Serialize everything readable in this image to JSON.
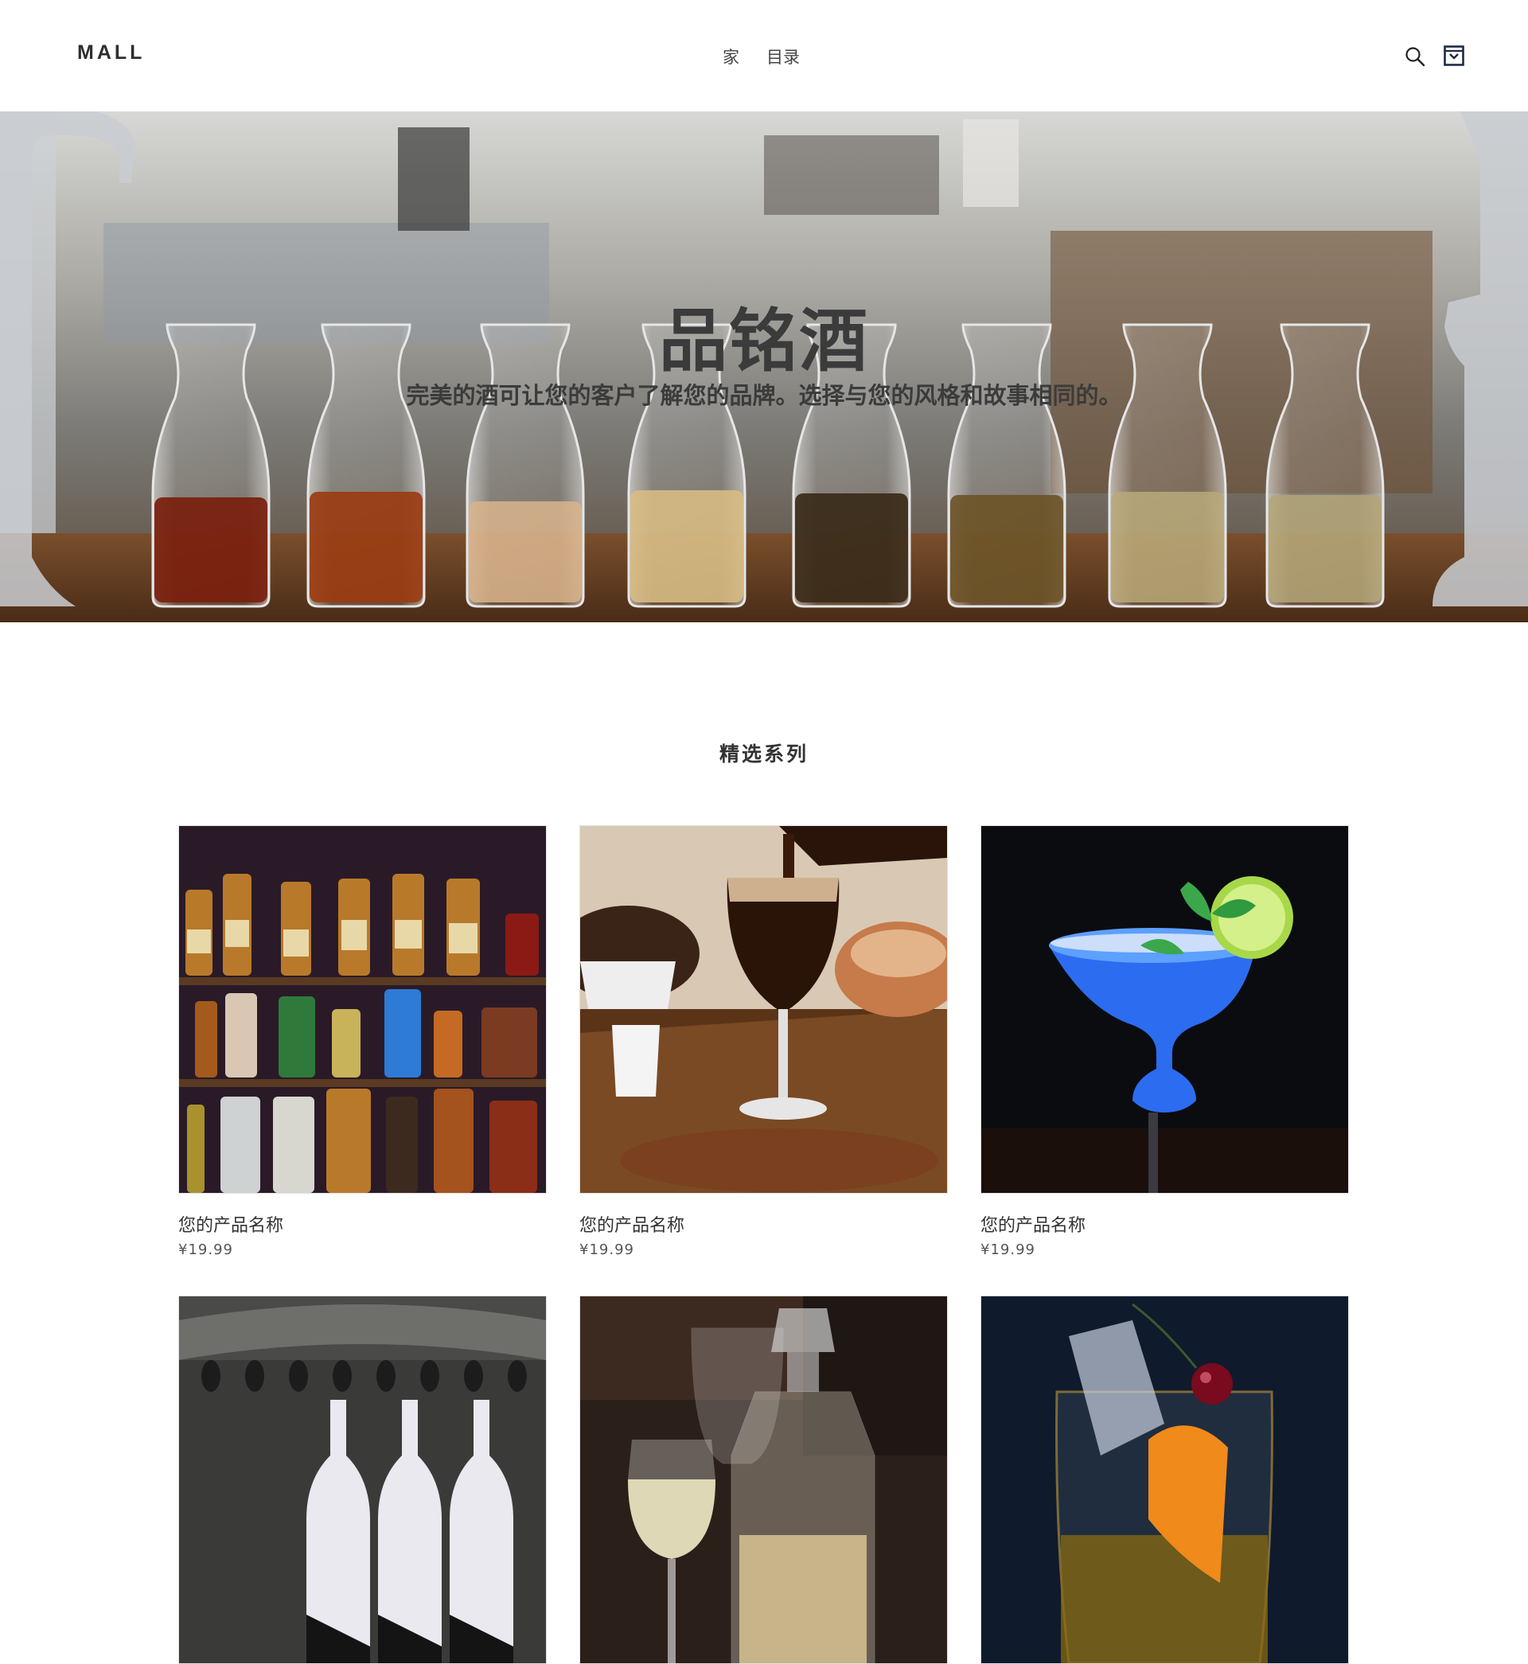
{
  "header": {
    "logo": "MALL",
    "nav": [
      {
        "label": "家"
      },
      {
        "label": "目录"
      }
    ],
    "icons": [
      "search-icon",
      "cart-icon"
    ]
  },
  "hero": {
    "title": "品铭酒",
    "subtitle": "完美的酒可让您的客户了解您的品牌。选择与您的风格和故事相同的。"
  },
  "featured": {
    "title": "精选系列",
    "products": [
      {
        "name": "您的产品名称",
        "price": "¥19.99",
        "image": "whisky-bottle-shelf"
      },
      {
        "name": "您的产品名称",
        "price": "¥19.99",
        "image": "dark-beer-pour"
      },
      {
        "name": "您的产品名称",
        "price": "¥19.99",
        "image": "blue-margarita"
      },
      {
        "name": "",
        "price": "",
        "image": "champagne-bottles"
      },
      {
        "name": "",
        "price": "",
        "image": "crystal-decanter"
      },
      {
        "name": "",
        "price": "",
        "image": "orange-cocktail-cherry"
      }
    ]
  },
  "colors": {
    "text": "#333333",
    "cart_accent": "#1f2a44"
  }
}
